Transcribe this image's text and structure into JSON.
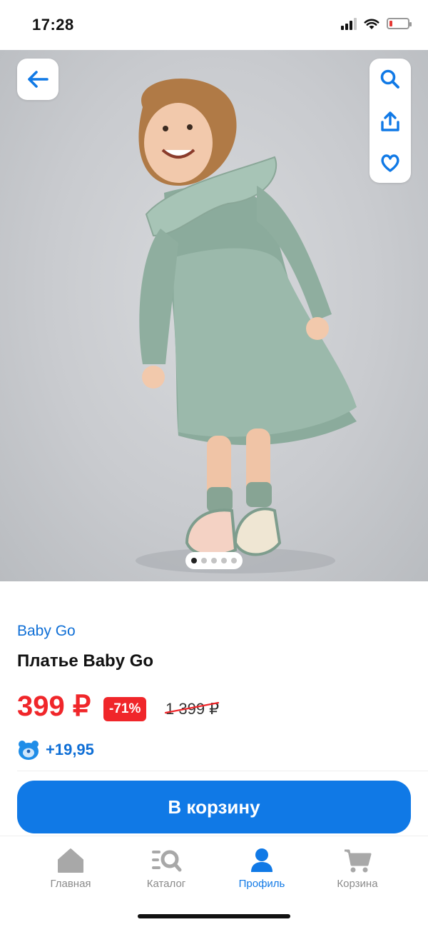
{
  "status_bar": {
    "time": "17:28"
  },
  "gallery": {
    "image_count": 5,
    "active_index": 0,
    "icons": [
      "arrow-left-icon",
      "search-icon",
      "share-icon",
      "heart-icon"
    ]
  },
  "product": {
    "brand": "Baby Go",
    "title": "Платье Baby Go",
    "price": "399 ₽",
    "discount": "-71%",
    "old_price": "1 399 ₽",
    "bonus": "+19,95"
  },
  "cart_button": {
    "label": "В корзину"
  },
  "tabbar": {
    "tabs": [
      {
        "label": "Главная",
        "icon": "home-icon",
        "active": false
      },
      {
        "label": "Каталог",
        "icon": "catalog-search-icon",
        "active": false
      },
      {
        "label": "Профиль",
        "icon": "profile-icon",
        "active": true
      },
      {
        "label": "Корзина",
        "icon": "cart-icon",
        "active": false
      }
    ]
  },
  "colors": {
    "accent": "#1079e6",
    "price_red": "#f0262a",
    "link_blue": "#0f6fd6",
    "inactive_gray": "#8a8a8a"
  }
}
